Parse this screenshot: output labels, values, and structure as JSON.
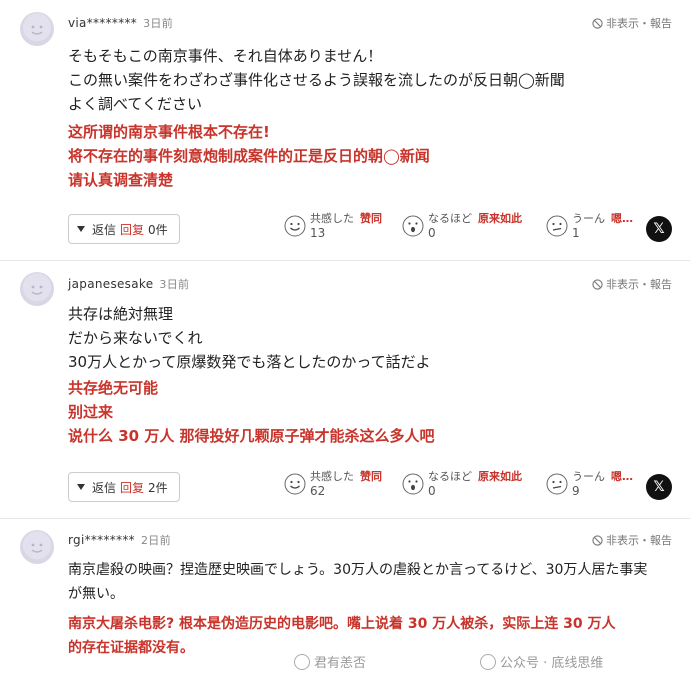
{
  "hide_label": "非表示・報告",
  "reply_label": "返信",
  "reply_cn": "回复",
  "reactions": {
    "empathy": "共感した",
    "empathy_cn": "赞同",
    "naruhodo": "なるほど",
    "naruhodo_cn": "原来如此",
    "uun": "うーん",
    "uun_cn": "嗯…"
  },
  "comments": [
    {
      "author": "via********",
      "time": "3日前",
      "jp": [
        "そもそもこの南京事件、それ自体ありません！",
        "この無い案件をわざわざ事件化させるよう誤報を流したのが反日朝◯新聞",
        "よく調べてください"
      ],
      "cn": [
        "这所谓的南京事件根本不存在!",
        "将不存在的事件刻意炮制成案件的正是反日的朝◯新闻",
        "请认真调查清楚"
      ],
      "replies": "0件",
      "counts": {
        "empathy": "13",
        "naruhodo": "0",
        "uun": "1"
      }
    },
    {
      "author": "japanesesake",
      "time": "3日前",
      "jp": [
        "共存は絶対無理",
        "だから来ないでくれ",
        "30万人とかって原爆数発でも落としたのかって話だよ"
      ],
      "cn": [
        "共存绝无可能",
        "别过来",
        "说什么 30 万人 那得投好几颗原子弹才能杀这么多人吧"
      ],
      "replies": "2件",
      "counts": {
        "empathy": "62",
        "naruhodo": "0",
        "uun": "9"
      }
    },
    {
      "author": "rgi********",
      "time": "2日前",
      "jp": [
        "南京虐殺の映画？捏造歴史映画でしょう。30万人の虐殺とか言ってるけど、30万人居た事実",
        "が無い。"
      ],
      "cn": [
        "南京大屠杀电影? 根本是伪造历史的电影吧。嘴上说着 30 万人被杀，实际上连 30 万人",
        "的存在证据都没有。"
      ]
    }
  ],
  "watermark": {
    "left": "君有恙否",
    "right": "公众号 · 底线思维"
  }
}
